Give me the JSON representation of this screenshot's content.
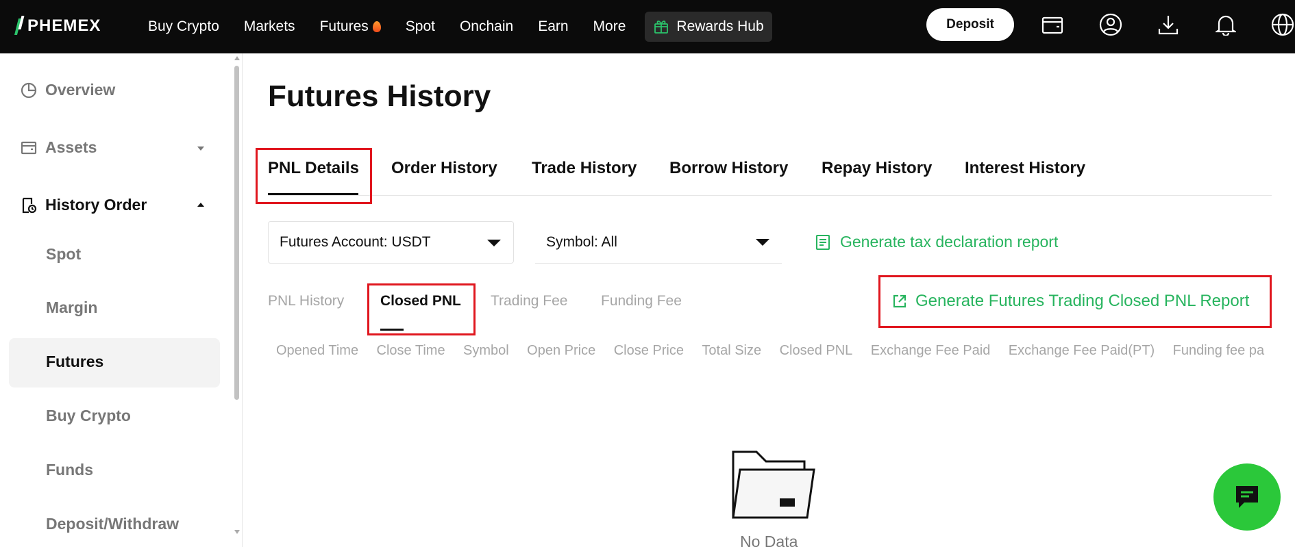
{
  "brand": {
    "name": "PHEMEX",
    "accent": "#2bc36b"
  },
  "nav": {
    "items": [
      "Buy Crypto",
      "Markets",
      "Futures",
      "Spot",
      "Onchain",
      "Earn",
      "More"
    ],
    "rewards_label": "Rewards Hub",
    "deposit_label": "Deposit",
    "icons": [
      "wallet-icon",
      "user-icon",
      "download-icon",
      "bell-icon",
      "globe-icon"
    ]
  },
  "sidebar": {
    "overview": "Overview",
    "assets": "Assets",
    "history_order": "History Order",
    "sub_items": [
      "Spot",
      "Margin",
      "Futures",
      "Buy Crypto",
      "Funds",
      "Deposit/Withdraw"
    ],
    "active_sub": "Futures"
  },
  "page": {
    "title": "Futures History",
    "tabs": [
      "PNL Details",
      "Order History",
      "Trade History",
      "Borrow History",
      "Repay History",
      "Interest History"
    ],
    "active_tab": "PNL Details"
  },
  "filters": {
    "account": "Futures Account: USDT",
    "symbol": "Symbol: All",
    "tax_report": "Generate tax declaration report"
  },
  "subtabs": {
    "items": [
      "PNL History",
      "Closed PNL",
      "Trading Fee",
      "Funding Fee"
    ],
    "active": "Closed PNL"
  },
  "report_link": "Generate Futures Trading Closed PNL Report",
  "table": {
    "columns": [
      "Opened Time",
      "Close Time",
      "Symbol",
      "Open Price",
      "Close Price",
      "Total Size",
      "Closed PNL",
      "Exchange Fee Paid",
      "Exchange Fee Paid(PT)",
      "Funding fee pa"
    ]
  },
  "empty_state": "No Data",
  "colors": {
    "highlight": "#e0161e",
    "link_green": "#27b45e",
    "chat_green": "#2bc83a"
  }
}
